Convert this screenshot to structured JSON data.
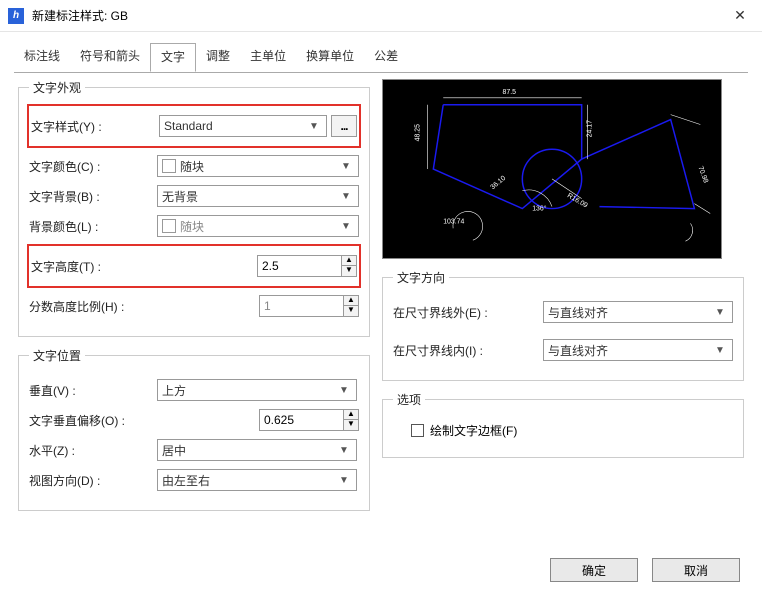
{
  "title": "新建标注样式: GB",
  "tabs": [
    "标注线",
    "符号和箭头",
    "文字",
    "调整",
    "主单位",
    "换算单位",
    "公差"
  ],
  "active_tab_index": 2,
  "appearance": {
    "legend": "文字外观",
    "style_label": "文字样式(Y) :",
    "style_value": "Standard",
    "ellipsis": "...",
    "color_label": "文字颜色(C) :",
    "color_value": "随块",
    "bg_label": "文字背景(B) :",
    "bg_value": "无背景",
    "bgcolor_label": "背景颜色(L) :",
    "bgcolor_value": "随块",
    "height_label": "文字高度(T) :",
    "height_value": "2.5",
    "fraction_label": "分数高度比例(H) :",
    "fraction_value": "1"
  },
  "position": {
    "legend": "文字位置",
    "vertical_label": "垂直(V) :",
    "vertical_value": "上方",
    "offset_label": "文字垂直偏移(O) :",
    "offset_value": "0.625",
    "horizontal_label": "水平(Z) :",
    "horizontal_value": "居中",
    "view_label": "视图方向(D) :",
    "view_value": "由左至右"
  },
  "direction": {
    "legend": "文字方向",
    "outside_label": "在尺寸界线外(E) :",
    "outside_value": "与直线对齐",
    "inside_label": "在尺寸界线内(I) :",
    "inside_value": "与直线对齐"
  },
  "options": {
    "legend": "选项",
    "frame_label": "绘制文字边框(F)"
  },
  "preview": {
    "dim1": "87.5",
    "dim2": "48.25",
    "dim3": "24.17",
    "dim4": "70.98",
    "dim5": "36.10",
    "dim6": "R16.09",
    "dim7": "136°",
    "dim8": "103.74"
  },
  "buttons": {
    "ok": "确定",
    "cancel": "取消"
  }
}
